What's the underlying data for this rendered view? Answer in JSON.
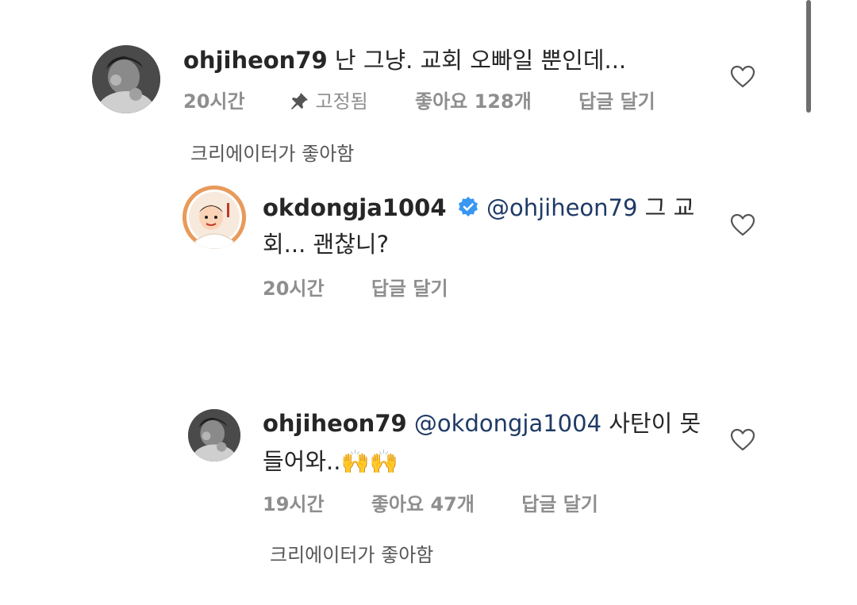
{
  "comments": [
    {
      "username": "ohjiheon79",
      "text": " 난 그냥.  교회 오빠일 뿐인데...",
      "time": "20시간",
      "pinned_label": "고정됨",
      "likes": "좋아요 128개",
      "reply_label": "답글 달기",
      "creator_liked": "크리에이터가 좋아함",
      "avatar_icon": "person-photo-avatar"
    },
    {
      "username": "okdongja1004",
      "mention": "@ohjiheon79",
      "text_line1": " 그 교",
      "text_line2": "회... 괜찮니?",
      "time": "20시간",
      "reply_label": "답글 달기",
      "verified_icon": "verified-badge-icon",
      "avatar_icon": "cartoon-character-avatar",
      "verified_color": "#3897f0",
      "ring_color": "#e89a5a"
    },
    {
      "username": "ohjiheon79",
      "mention": "@okdongja1004",
      "text_line1": " 사탄이 못",
      "text_line2": "들어와..",
      "emoji": "🙌🙌",
      "time": "19시간",
      "likes": "좋아요 47개",
      "reply_label": "답글 달기",
      "creator_liked": "크리에이터가 좋아함",
      "avatar_icon": "person-photo-avatar"
    }
  ],
  "icons": {
    "heart": "heart-outline-icon",
    "pin": "pin-icon"
  }
}
